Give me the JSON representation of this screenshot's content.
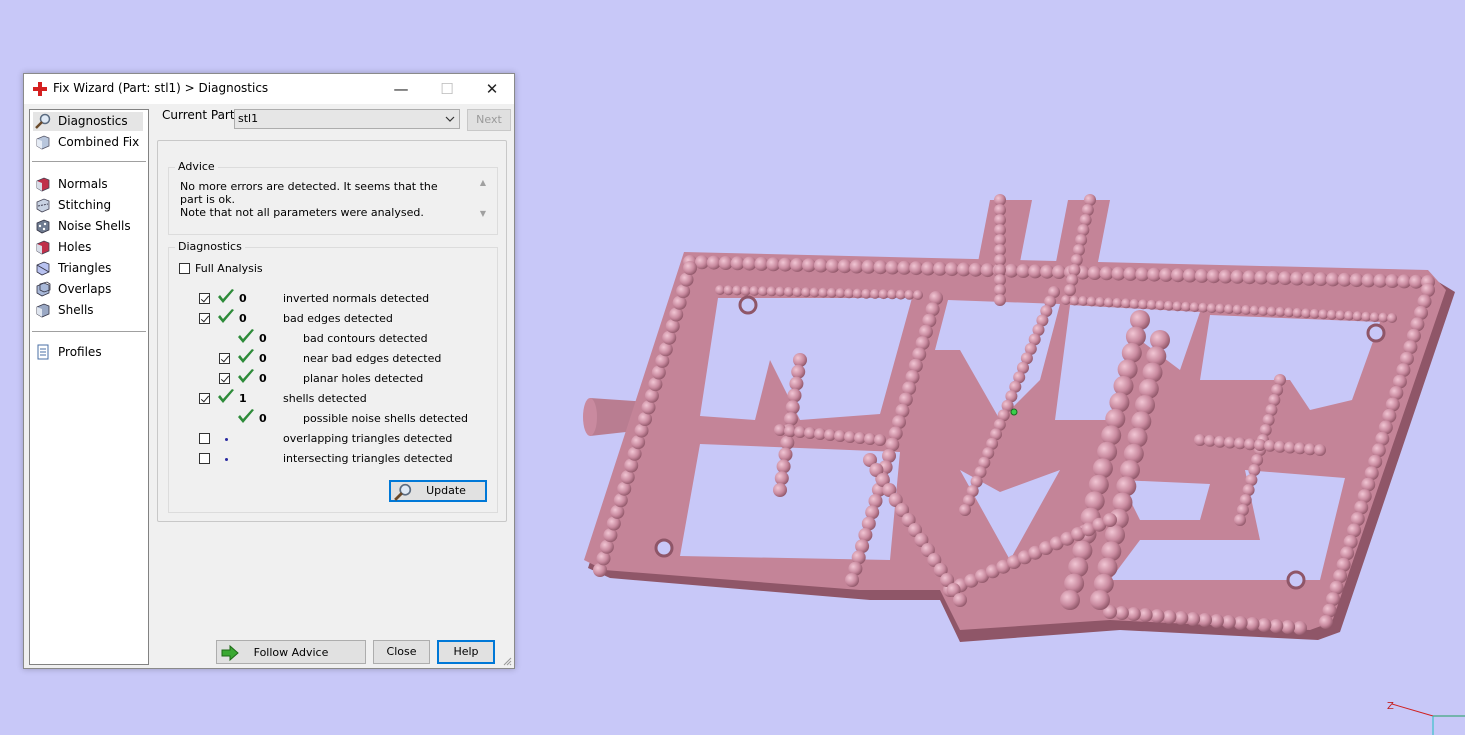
{
  "window": {
    "title": "Fix Wizard (Part: stl1) > Diagnostics"
  },
  "nav": {
    "top": [
      {
        "label": "Diagnostics",
        "icon": "magnifier-icon",
        "selected": true
      },
      {
        "label": "Combined Fix",
        "icon": "cube-icon"
      }
    ],
    "tools": [
      {
        "label": "Normals",
        "icon": "normals-icon"
      },
      {
        "label": "Stitching",
        "icon": "stitching-icon"
      },
      {
        "label": "Noise Shells",
        "icon": "noise-shells-icon"
      },
      {
        "label": "Holes",
        "icon": "holes-icon"
      },
      {
        "label": "Triangles",
        "icon": "triangles-icon"
      },
      {
        "label": "Overlaps",
        "icon": "overlaps-icon"
      },
      {
        "label": "Shells",
        "icon": "shells-icon"
      }
    ],
    "bottom": [
      {
        "label": "Profiles",
        "icon": "document-icon"
      }
    ]
  },
  "current_part": {
    "label": "Current Part:",
    "value": "stl1",
    "next_label": "Next"
  },
  "advice": {
    "title": "Advice",
    "line1": "No more errors are detected. It seems that the part is ok.",
    "line2": "Note that not all parameters were analysed."
  },
  "diagnostics": {
    "title": "Diagnostics",
    "full_analysis_label": "Full Analysis",
    "full_analysis_checked": false,
    "rows": [
      {
        "checkbox": true,
        "checked": true,
        "status": "ok",
        "count": "0",
        "label": "inverted normals detected",
        "indent": false
      },
      {
        "checkbox": true,
        "checked": true,
        "status": "ok",
        "count": "0",
        "label": "bad edges detected",
        "indent": false
      },
      {
        "checkbox": false,
        "checked": false,
        "status": "ok",
        "count": "0",
        "label": "bad contours detected",
        "indent": true
      },
      {
        "checkbox": true,
        "checked": true,
        "status": "ok",
        "count": "0",
        "label": "near bad edges detected",
        "indent": true
      },
      {
        "checkbox": true,
        "checked": true,
        "status": "ok",
        "count": "0",
        "label": "planar holes detected",
        "indent": true
      },
      {
        "checkbox": true,
        "checked": true,
        "status": "ok",
        "count": "1",
        "label": "shells detected",
        "indent": false
      },
      {
        "checkbox": false,
        "checked": false,
        "status": "ok",
        "count": "0",
        "label": "possible noise shells detected",
        "indent": true
      },
      {
        "checkbox": true,
        "checked": false,
        "status": "pending",
        "count": "",
        "label": "overlapping triangles detected",
        "indent": false
      },
      {
        "checkbox": true,
        "checked": false,
        "status": "pending",
        "count": "",
        "label": "intersecting triangles detected",
        "indent": false
      }
    ],
    "update_label": "Update"
  },
  "footer": {
    "follow_advice_label": "Follow Advice",
    "close_label": "Close",
    "help_label": "Help"
  },
  "viewport": {
    "background": "#c8c8f8",
    "model_color": "#c98a9f",
    "axis_label": "Z"
  },
  "colors": {
    "tick": "#2e8b3a",
    "arrow": "#3aa832",
    "focus": "#0078d7",
    "title_icon": "#d42020"
  }
}
